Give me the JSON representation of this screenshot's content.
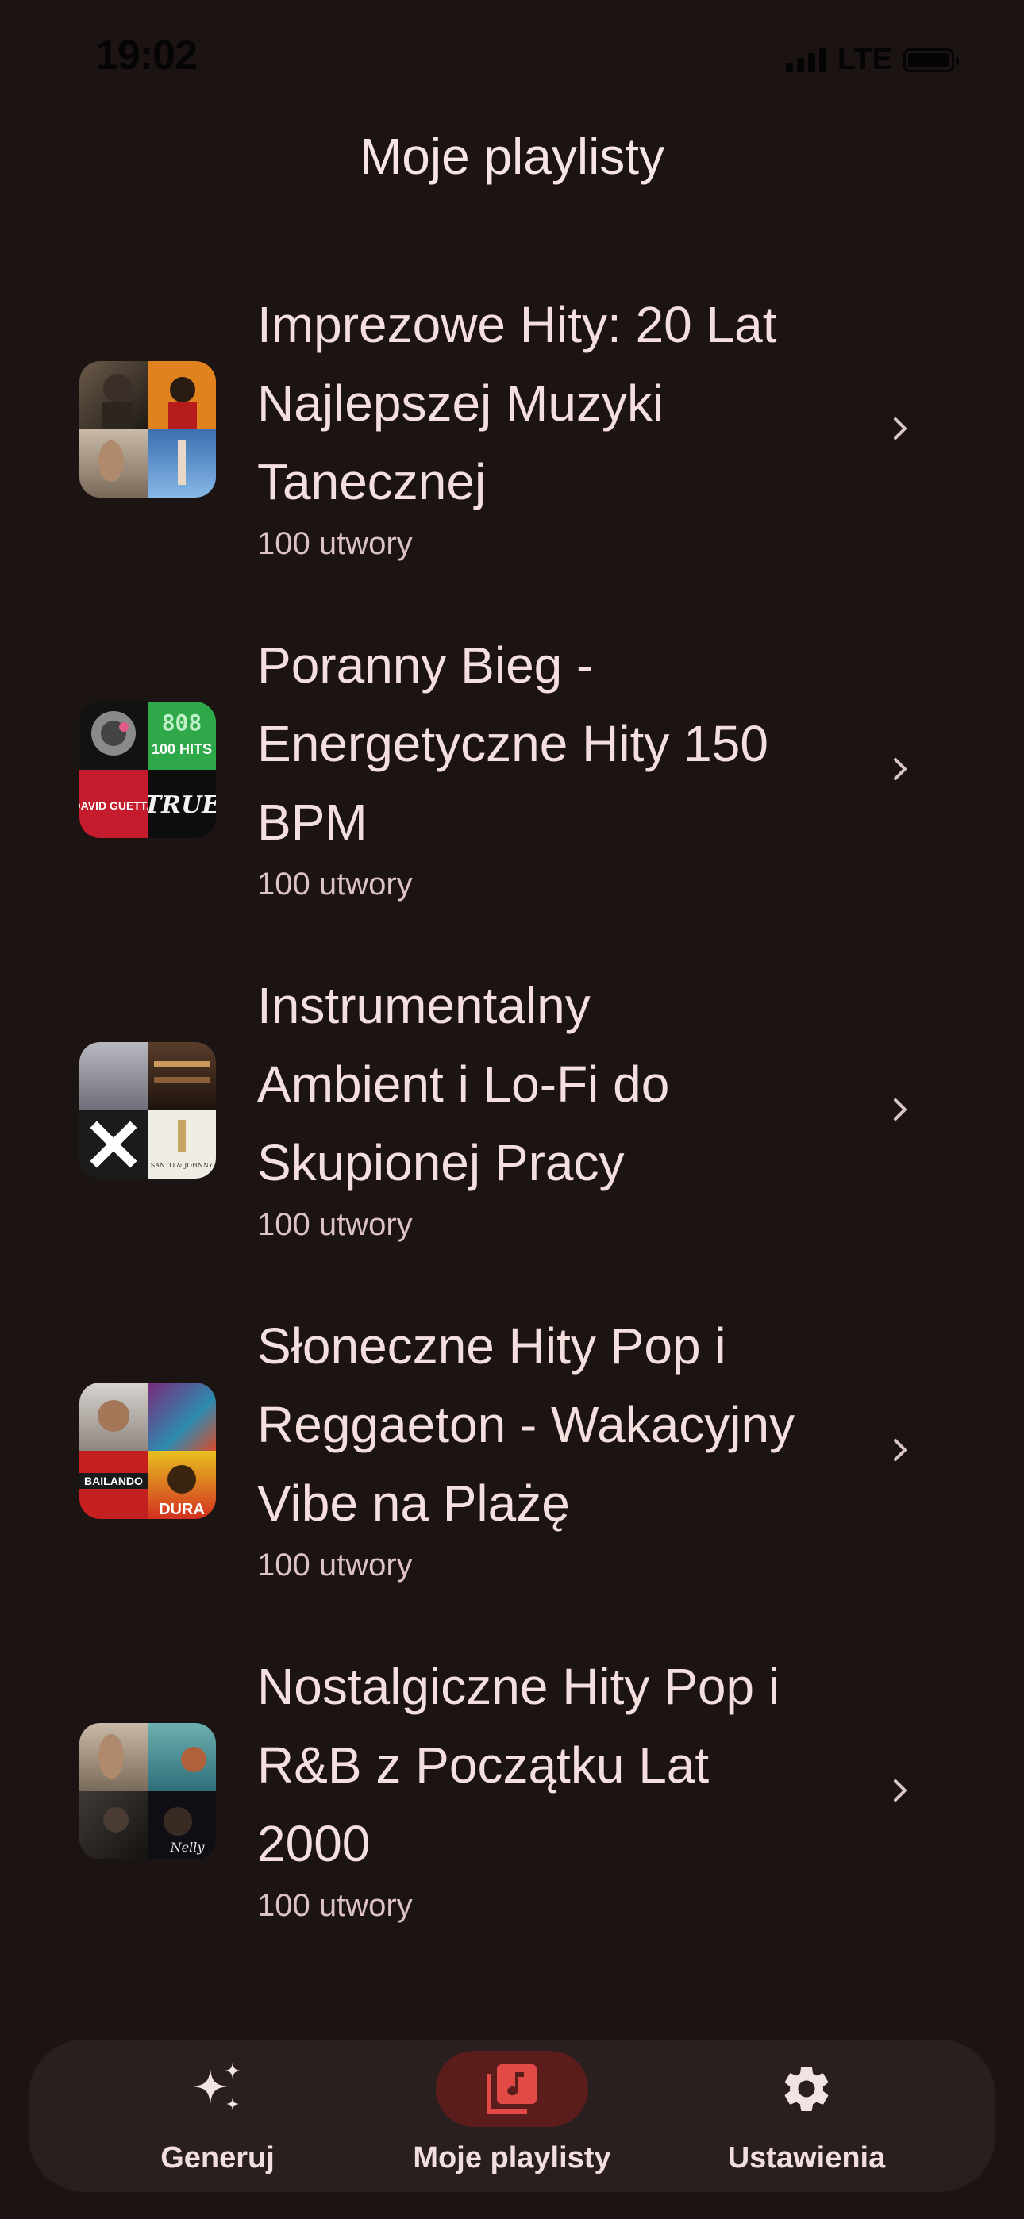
{
  "status_bar": {
    "time": "19:02",
    "network": "LTE"
  },
  "header": {
    "title": "Moje playlisty"
  },
  "playlists": [
    {
      "title_lines": [
        "Imprezowe Hity: 20 Lat",
        "Najlepszej Muzyki",
        "Tanecznej"
      ],
      "count": "100 utwory"
    },
    {
      "title_lines": [
        "Poranny Bieg -",
        "Energetyczne Hity 150",
        "BPM"
      ],
      "count": "100 utwory"
    },
    {
      "title_lines": [
        "Instrumentalny",
        "Ambient i Lo-Fi do",
        "Skupionej Pracy"
      ],
      "count": "100 utwory"
    },
    {
      "title_lines": [
        "Słoneczne Hity Pop i",
        "Reggaeton - Wakacyjny",
        "Vibe na Plażę"
      ],
      "count": "100 utwory"
    },
    {
      "title_lines": [
        "Nostalgiczne Hity Pop i",
        "R&B z Początku Lat",
        "2000"
      ],
      "count": "100 utwory"
    }
  ],
  "bottom_nav": {
    "items": [
      {
        "label": "Generuj",
        "icon": "sparkles-icon",
        "active": false
      },
      {
        "label": "Moje playlisty",
        "icon": "playlist-icon",
        "active": true
      },
      {
        "label": "Ustawienia",
        "icon": "gear-icon",
        "active": false
      }
    ]
  },
  "colors": {
    "background": "#1c1313",
    "text": "#f5dede",
    "subtext": "#dcc2c2",
    "nav_background": "#2a1f1f",
    "active_pill": "#5a1d1c",
    "accent": "#e24a45"
  }
}
